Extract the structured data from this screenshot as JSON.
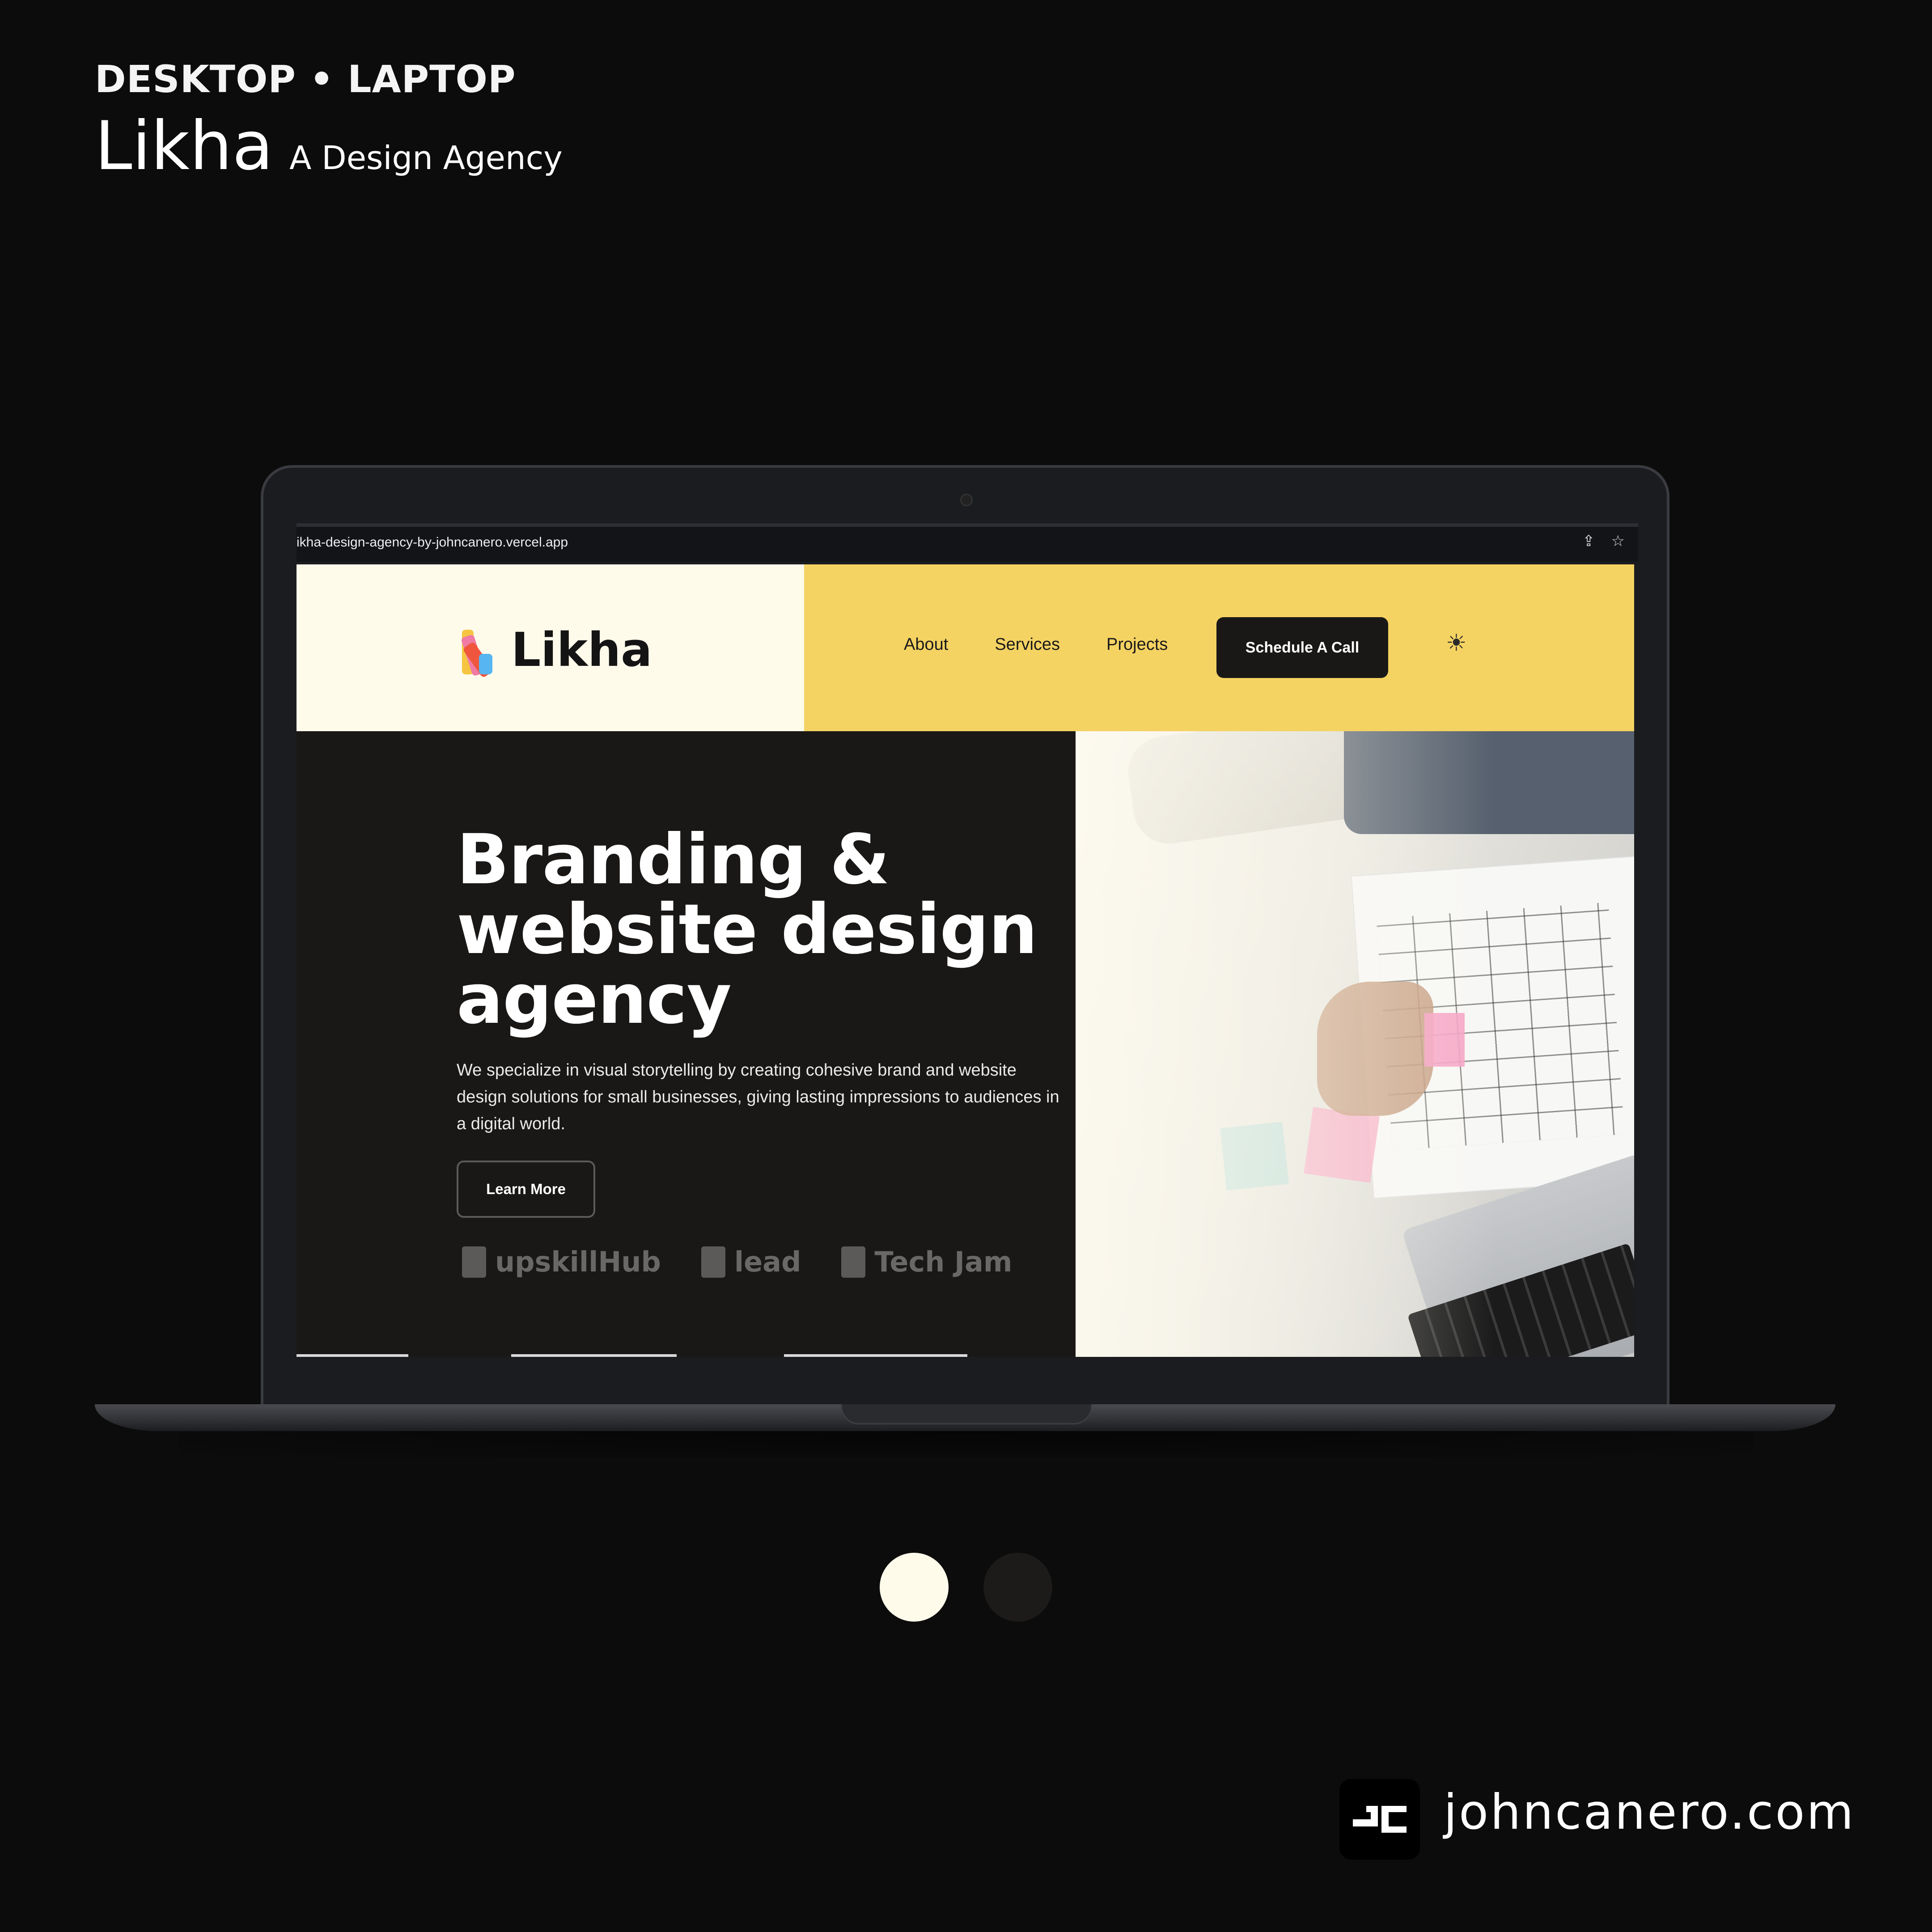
{
  "header": {
    "kicker": "DESKTOP • LAPTOP",
    "title": "Likha",
    "subtitle": "A Design Agency"
  },
  "browser": {
    "url": "ikha-design-agency-by-johncanero.vercel.app",
    "share_icon": "share-icon",
    "bookmark_icon": "star-icon"
  },
  "site": {
    "logo_text": "Likha",
    "nav": {
      "links": [
        "About",
        "Services",
        "Projects"
      ],
      "cta_label": "Schedule A Call",
      "theme_icon": "☀"
    },
    "hero": {
      "heading": "Branding & website design agency",
      "description": "We specialize in visual storytelling by creating cohesive brand and website design solutions for small businesses, giving lasting impressions to audiences in a digital world.",
      "button_label": "Learn More",
      "partners": [
        "upskillHub",
        "lead",
        "Tech Jam"
      ]
    },
    "colors": {
      "nav_left_bg": "#fffbeb",
      "nav_right_bg": "#f5d362",
      "hero_bg": "#1a1816",
      "cta_bg": "#1a1816"
    }
  },
  "slider": {
    "count": 2,
    "active": 1
  },
  "footer": {
    "brand_url": "johncanero.com"
  }
}
